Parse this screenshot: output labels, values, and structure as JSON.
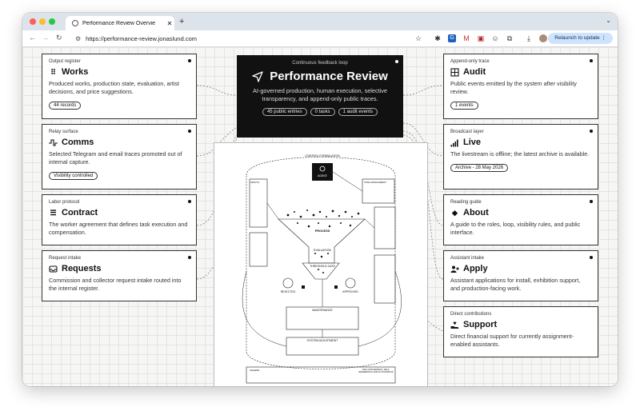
{
  "browser": {
    "tab_title": "Performance Review Overvie",
    "tab_close": "✕",
    "new_tab": "+",
    "url": "https://performance-review.jonaslund.com",
    "relaunch_label": "Relaunch to update"
  },
  "hero": {
    "kicker": "Continuous feedback loop",
    "title": "Performance Review",
    "subtitle": "AI-governed production, human execution, selective transparency, and append-only public traces.",
    "pills": [
      "45 public entries",
      "0 tasks",
      "1 audit events"
    ]
  },
  "left_cards": [
    {
      "label": "Output register",
      "icon": "grid-dots-icon",
      "title": "Works",
      "desc": "Produced works, production state, evaluation, artist decisions, and price suggestions.",
      "pill": "44 records"
    },
    {
      "label": "Relay surface",
      "icon": "pulse-icon",
      "title": "Comms",
      "desc": "Selected Telegram and email traces promoted out of internal capture.",
      "pill": "Visibility controlled"
    },
    {
      "label": "Labor protocol",
      "icon": "lines-icon",
      "title": "Contract",
      "desc": "The worker agreement that defines task execution and compensation.",
      "pill": ""
    },
    {
      "label": "Request intake",
      "icon": "inbox-icon",
      "title": "Requests",
      "desc": "Commission and collector request intake routed into the internal register.",
      "pill": ""
    }
  ],
  "right_cards": [
    {
      "label": "Append-only trace",
      "icon": "table-icon",
      "title": "Audit",
      "desc": "Public events emitted by the system after visibility review.",
      "pill": "1 events"
    },
    {
      "label": "Broadcast layer",
      "icon": "signal-icon",
      "title": "Live",
      "desc": "The livestream is offline; the latest archive is available.",
      "pill": "Archive - 28 May 2026"
    },
    {
      "label": "Reading guide",
      "icon": "diamond-icon",
      "title": "About",
      "desc": "A guide to the roles, loop, visibility rules, and public interface.",
      "pill": ""
    },
    {
      "label": "Assistant intake",
      "icon": "user-plus-icon",
      "title": "Apply",
      "desc": "Assistant applications for install, exhibition support, and production-facing work.",
      "pill": ""
    },
    {
      "label": "Direct contributions",
      "icon": "hand-heart-icon",
      "title": "Support",
      "desc": "Direct financial support for currently assignment-enabled assistants.",
      "pill": ""
    }
  ],
  "diagram": {
    "top_label": "CONTROL FORMULATION",
    "agent": "AGENT",
    "left_box": "INPUTS",
    "right_box": "TASK ASSIGNMENT",
    "process": "PROCESS",
    "evaluation": "EVALUATION",
    "threshold": "THRESHOLD GATE",
    "rejected": "REJECTED",
    "approved": "APPROVED",
    "maintenance": "MAINTENANCE",
    "adjustment": "SYSTEM ADJUSTMENT",
    "legend": "LEGEND",
    "footer": "THE LOOP REPEATS, SELF-REFERENTIAL AND AUTONOMOUS"
  },
  "colors": {
    "accent": "#111111",
    "relaunch_bg": "#cfe3fc",
    "titlebar": "#dde3ea"
  }
}
